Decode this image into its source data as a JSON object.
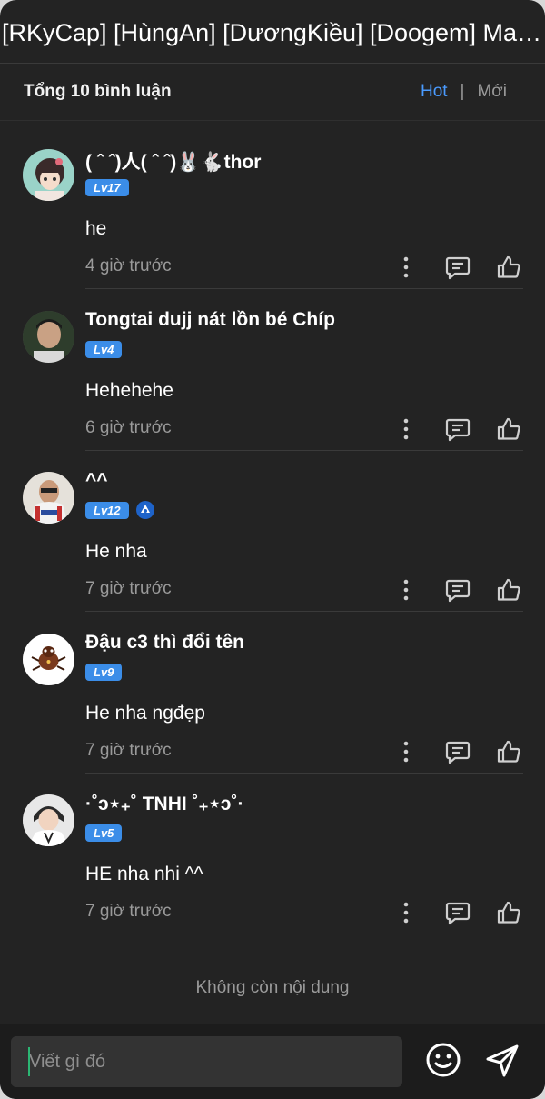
{
  "header": {
    "title": "[RKyCap] [HùngAn] [DươngKiều] [Doogem] Ma ..."
  },
  "summary": {
    "count_label": "Tổng 10 bình luận",
    "sort_hot": "Hot",
    "sort_separator": "|",
    "sort_new": "Mới",
    "active_sort": "Hot"
  },
  "comments": [
    {
      "name": "( ˆ ˆ)人( ˆ ˆ)🐰🐇thor",
      "level": "Lv17",
      "text": "he",
      "time": "4 giờ trước",
      "verified": false
    },
    {
      "name": "Tongtai dujj nát lồn bé Chíp",
      "level": "Lv4",
      "text": "Hehehehe",
      "time": "6 giờ trước",
      "verified": false
    },
    {
      "name": "^^",
      "level": "Lv12",
      "text": "He nha",
      "time": "7 giờ trước",
      "verified": true
    },
    {
      "name": "Đậu c3 thì đổi tên",
      "level": "Lv9",
      "text": "He nha ngđẹp",
      "time": "7 giờ trước",
      "verified": false
    },
    {
      "name": "·˚ↄ⋆₊˚ TNHI ˚₊⋆ↄ˚·",
      "level": "Lv5",
      "text": "HE nha nhi ^^",
      "time": "7 giờ trước",
      "verified": false
    }
  ],
  "footer": {
    "end_label": "Không còn nội dung"
  },
  "composer": {
    "placeholder": "Viết gì đó"
  },
  "icons": {
    "more": "more-vertical-icon",
    "reply": "comment-icon",
    "like": "thumbs-up-icon",
    "emoji": "smiley-icon",
    "send": "send-icon",
    "verified": "blue-badge-icon"
  },
  "colors": {
    "background": "#232323",
    "accent": "#4a9bff",
    "level_badge": "#3b8de8",
    "muted_text": "#9a9a9a",
    "caret": "#2bb673"
  }
}
